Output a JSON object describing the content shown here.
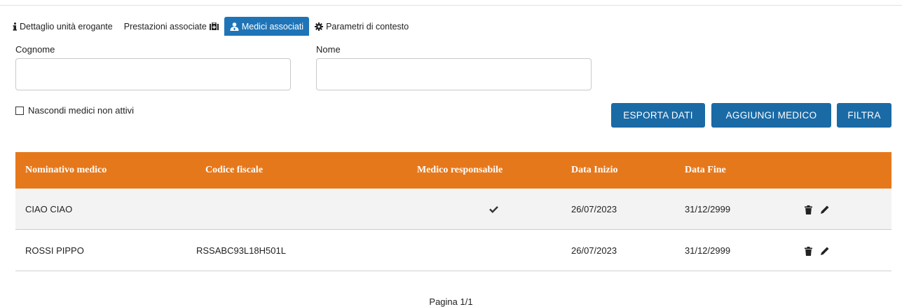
{
  "tabs": [
    {
      "label": "Dettaglio unità erogante",
      "icon": "info-icon",
      "active": false
    },
    {
      "label": "Prestazioni associate",
      "icon": "medkit-icon",
      "active": false
    },
    {
      "label": "Medici associati",
      "icon": "user-md-icon",
      "active": true
    },
    {
      "label": "Parametri di contesto",
      "icon": "gear-icon",
      "active": false
    }
  ],
  "filters": {
    "cognome_label": "Cognome",
    "cognome_value": "",
    "nome_label": "Nome",
    "nome_value": "",
    "hide_inactive_label": "Nascondi medici non attivi",
    "hide_inactive_checked": false
  },
  "buttons": {
    "export_label": "ESPORTA DATI",
    "add_label": "AGGIUNGI MEDICO",
    "filter_label": "FILTRA"
  },
  "colors": {
    "tab_active": "#1f74b7",
    "button": "#1a6aa6",
    "table_header": "#e6781c"
  },
  "table": {
    "headers": {
      "nominativo": "Nominativo medico",
      "codice_fiscale": "Codice fiscale",
      "responsabile": "Medico responsabile",
      "data_inizio": "Data Inizio",
      "data_fine": "Data Fine"
    },
    "rows": [
      {
        "nominativo": "CIAO CIAO",
        "codice_fiscale": "",
        "responsabile": true,
        "data_inizio": "26/07/2023",
        "data_fine": "31/12/2999"
      },
      {
        "nominativo": "ROSSI PIPPO",
        "codice_fiscale": "RSSABC93L18H501L",
        "responsabile": false,
        "data_inizio": "26/07/2023",
        "data_fine": "31/12/2999"
      }
    ]
  },
  "pager": {
    "text": "Pagina 1/1"
  }
}
